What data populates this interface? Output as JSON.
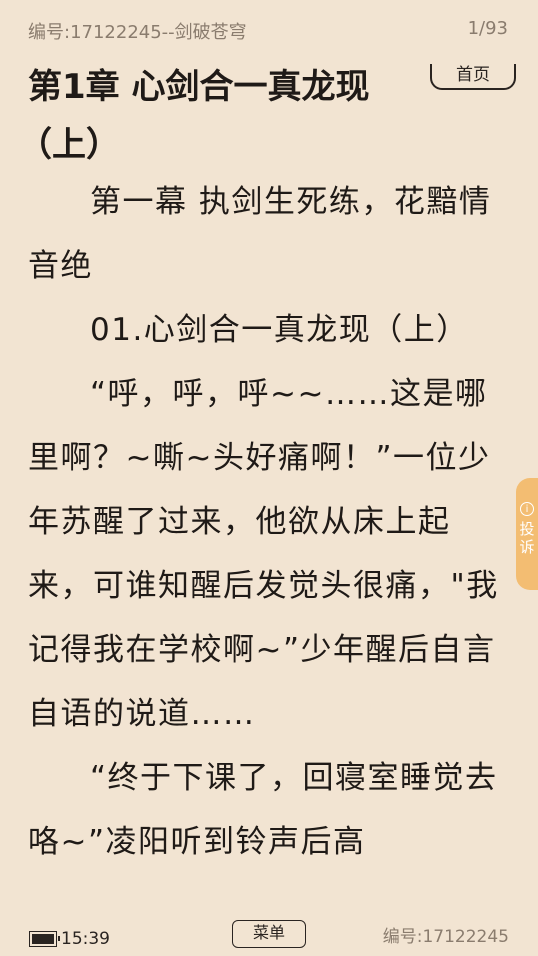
{
  "header": {
    "book_meta": "编号:17122245--剑破苍穹",
    "page_indicator": "1/93",
    "home_label": "首页"
  },
  "chapter": {
    "title_line1": "第1章 心剑合一真龙现",
    "title_line2": "（上）"
  },
  "content": {
    "paragraphs": [
      "第一幕 执剑生死练，花黯情音绝",
      "01.心剑合一真龙现（上）",
      "“呼，呼，呼~~……这是哪里啊？~嘶~头好痛啊！”一位少年苏醒了过来，他欲从床上起来，可谁知醒后发觉头很痛，\"我记得我在学校啊~”少年醒后自言自语的说道……",
      "“终于下课了，回寝室睡觉去咯~”凌阳听到铃声后高"
    ]
  },
  "side_tab": {
    "info_symbol": "i",
    "label": "投诉"
  },
  "footer": {
    "time": "15:39",
    "menu_label": "菜单",
    "book_id": "编号:17122245"
  }
}
